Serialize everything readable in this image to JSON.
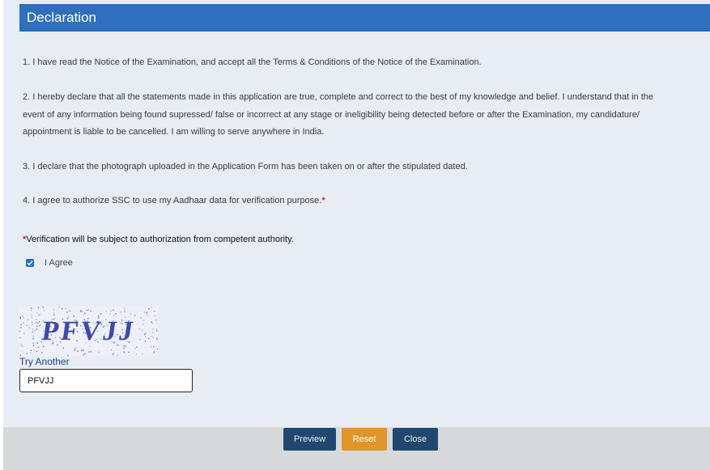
{
  "header": {
    "title": "Declaration"
  },
  "declarations": {
    "p1": "1. I have read the Notice of the Examination, and accept all the Terms & Conditions of the Notice of the Examination.",
    "p2_line1": "2. I hereby declare that all the statements made in this application are true, complete and correct to the best of my knowledge and belief. I understand that in the",
    "p2_line2": "event of any information being found supressed/ false or incorrect at any stage or ineligibility being detected before or after the Examination, my candidature/",
    "p2_line3": "appointment is liable to be cancelled. I am willing to serve anywhere in India.",
    "p3": "3. I declare that the photograph uploaded in the Application Form has been taken on or after the stipulated dated.",
    "p4": "4. I agree to authorize SSC to use my Aadhaar data for verification purpose.",
    "required_mark": "*"
  },
  "verification_note": "Verification will be subject to authorization from competent authority.",
  "agree": {
    "label": "I Agree",
    "checked": true
  },
  "captcha": {
    "image_text": "PFVJJ",
    "try_another": "Try Another",
    "input_value": "PFVJJ"
  },
  "footer": {
    "preview_label": "Preview",
    "reset_label": "Reset",
    "close_label": "Close"
  },
  "colors": {
    "header_bg": "#2f6fbd",
    "panel_bg": "#e7edf3",
    "primary_button": "#22476f",
    "reset_button": "#e0952a",
    "required": "#d9262c"
  }
}
